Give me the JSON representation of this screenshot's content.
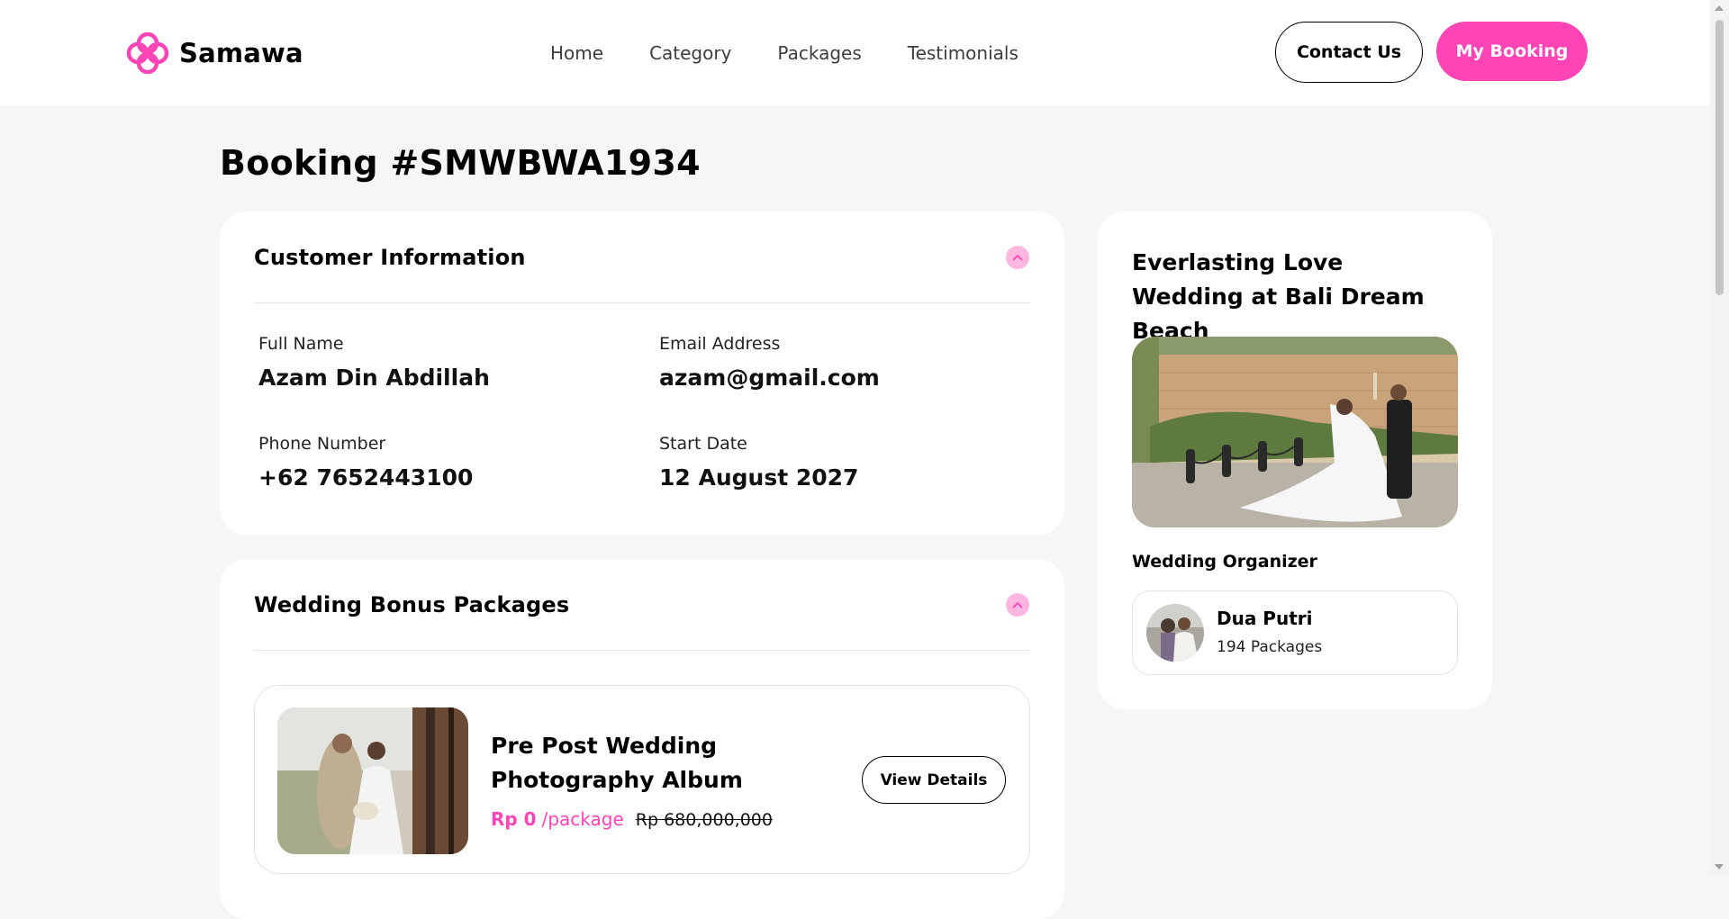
{
  "brand": {
    "name": "Samawa",
    "accent_color": "#ff45b5"
  },
  "nav": {
    "links": [
      {
        "label": "Home"
      },
      {
        "label": "Category"
      },
      {
        "label": "Packages"
      },
      {
        "label": "Testimonials"
      }
    ],
    "contact_label": "Contact Us",
    "booking_label": "My Booking"
  },
  "page": {
    "title": "Booking #SMWBWA1934"
  },
  "customer": {
    "title": "Customer Information",
    "toggle_icon": "chevron-up-icon",
    "fields": [
      {
        "label": "Full Name",
        "value": "Azam Din Abdillah"
      },
      {
        "label": "Email Address",
        "value": "azam@gmail.com"
      },
      {
        "label": "Phone Number",
        "value": "+62 7652443100"
      },
      {
        "label": "Start Date",
        "value": "12 August 2027"
      }
    ]
  },
  "bonus": {
    "title": "Wedding Bonus Packages",
    "toggle_icon": "chevron-up-icon",
    "items": [
      {
        "name": "Pre Post Wedding Photography Album",
        "price": "Rp 0",
        "unit": "/package",
        "original_price": "Rp 680,000,000",
        "view_label": "View Details"
      }
    ]
  },
  "package": {
    "name": "Everlasting Love Wedding at Bali Dream Beach",
    "organizer_label": "Wedding Organizer",
    "organizer": {
      "name": "Dua Putri",
      "count": "194 Packages"
    }
  }
}
